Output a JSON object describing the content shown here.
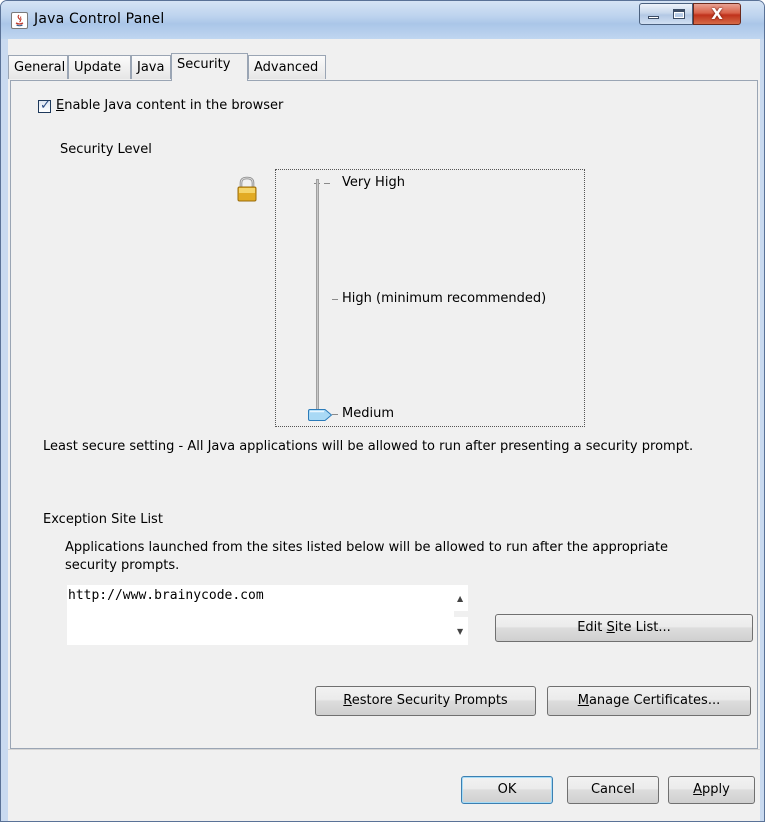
{
  "window": {
    "title": "Java Control Panel",
    "close_glyph": "X"
  },
  "tabs": [
    {
      "label": "General"
    },
    {
      "label": "Update"
    },
    {
      "label": "Java"
    },
    {
      "label": "Security",
      "active": true
    },
    {
      "label": "Advanced"
    }
  ],
  "security": {
    "enable_checkbox": {
      "mnemonic": "E",
      "rest": "nable Java content in the browser",
      "checked": true
    },
    "security_level_label": "Security Level",
    "levels": [
      "Very High",
      "High (minimum recommended)",
      "Medium"
    ],
    "selected_level": "Medium",
    "level_description": "Least secure setting - All Java applications will be allowed to run after presenting a security prompt.",
    "exception_site_list": {
      "title": "Exception Site List",
      "description": "Applications launched from the sites listed below will be allowed to run after the appropriate security prompts.",
      "sites": [
        "http://www.brainycode.com"
      ],
      "edit_button": {
        "before": "Edit ",
        "mnemonic": "S",
        "after": "ite List..."
      }
    },
    "restore_button": {
      "mnemonic": "R",
      "rest": "estore Security Prompts"
    },
    "manage_button": {
      "mnemonic": "M",
      "rest": "anage Certificates..."
    }
  },
  "footer": {
    "ok_label": "OK",
    "cancel_label": "Cancel",
    "apply_button": {
      "mnemonic": "A",
      "rest": "pply"
    }
  },
  "icons": {
    "app": "java-icon",
    "lock": "padlock-icon",
    "minimize": "minimize-icon",
    "maximize": "maximize-icon",
    "close": "close-icon",
    "scroll_up": "scroll-up-arrow-icon",
    "scroll_down": "scroll-down-arrow-icon"
  },
  "colors": {
    "title_bar": "#bdd3ee",
    "client_bg": "#f0f0f0",
    "close_button": "#c0321c",
    "lock": "#d9a521"
  }
}
